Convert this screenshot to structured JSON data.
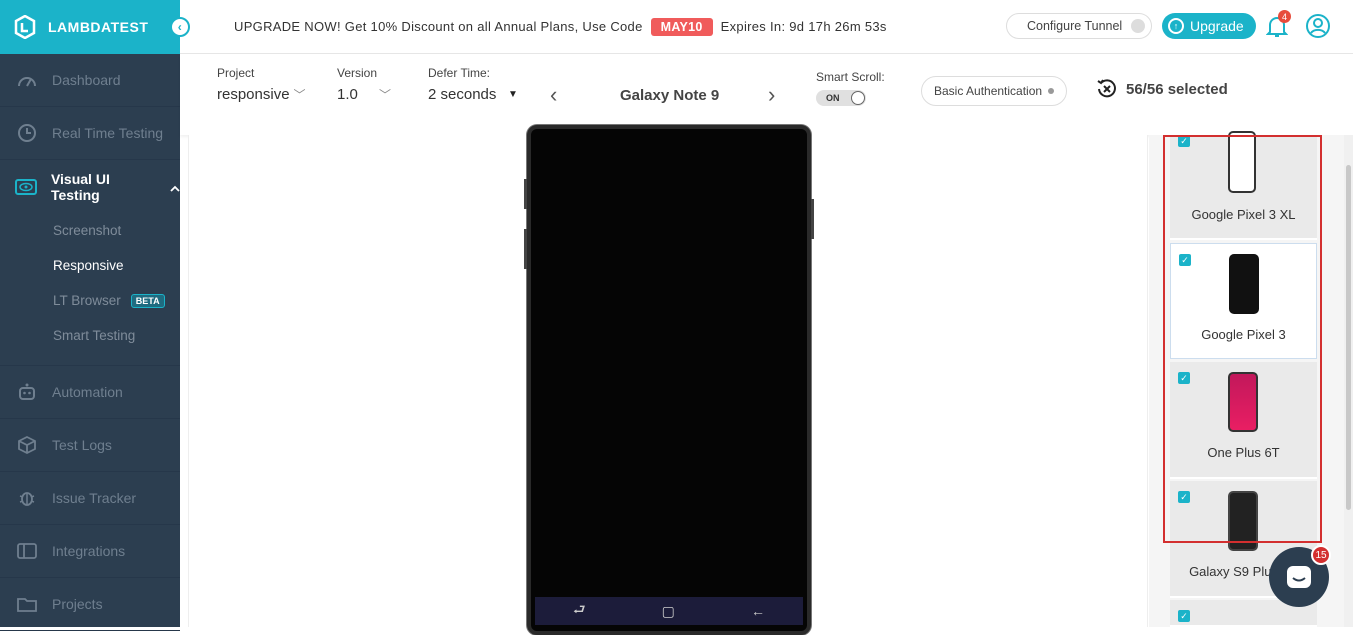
{
  "brand": {
    "name": "LAMBDATEST",
    "collapse_glyph": "‹"
  },
  "sidebar": {
    "items": [
      {
        "label": "Dashboard",
        "icon": "dashboard-icon"
      },
      {
        "label": "Real Time Testing",
        "icon": "clock-icon"
      },
      {
        "label": "Visual UI Testing",
        "icon": "eye-icon"
      },
      {
        "label": "Automation",
        "icon": "robot-icon"
      },
      {
        "label": "Test Logs",
        "icon": "box-icon"
      },
      {
        "label": "Issue Tracker",
        "icon": "bug-icon"
      },
      {
        "label": "Integrations",
        "icon": "integrations-icon"
      },
      {
        "label": "Projects",
        "icon": "folder-icon"
      }
    ],
    "subitems": [
      "Screenshot",
      "Responsive",
      "LT Browser",
      "Smart Testing"
    ],
    "beta_label": "BETA"
  },
  "topbar": {
    "promo_text": "UPGRADE NOW! Get 10% Discount on all Annual Plans, Use Code",
    "promo_code": "MAY10",
    "expires": "Expires In: 9d 17h 26m 53s",
    "tunnel_label": "Configure Tunnel",
    "upgrade_label": "Upgrade",
    "notification_count": "4"
  },
  "toolbar": {
    "project_label": "Project",
    "project_value": "responsive",
    "version_label": "Version",
    "version_value": "1.0",
    "defer_label": "Defer Time:",
    "defer_value": "2 seconds",
    "device_name": "Galaxy Note 9",
    "prev_glyph": "‹",
    "next_glyph": "›",
    "smart_scroll_label": "Smart Scroll:",
    "smart_scroll_state": "ON",
    "basic_auth_label": "Basic Authentication",
    "selected_count": "56/56 selected"
  },
  "devices": [
    {
      "name": "Google Pixel 3 XL",
      "checked": "✓"
    },
    {
      "name": "Google Pixel 3",
      "checked": "✓"
    },
    {
      "name": "One Plus 6T",
      "checked": "✓"
    },
    {
      "name": "Galaxy S9 Plus",
      "checked": "✓"
    },
    {
      "name": "",
      "checked": "✓"
    }
  ],
  "phone_nav": [
    "⮐",
    "▢",
    "←"
  ],
  "chat": {
    "badge": "15"
  },
  "colors": {
    "accent": "#1bb3c9",
    "sidebar": "#2c3e50",
    "promo_code_bg": "#f05b5b",
    "highlight_border": "#d32f2f"
  }
}
